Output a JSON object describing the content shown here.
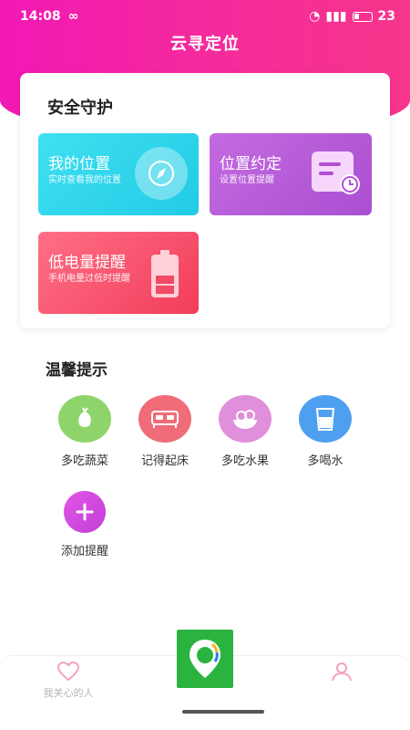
{
  "status_bar": {
    "time": "14:08",
    "battery_level": "23"
  },
  "app": {
    "title": "云寻定位"
  },
  "safety": {
    "title": "安全守护",
    "tiles": [
      {
        "title": "我的位置",
        "subtitle": "实时查看我的位置"
      },
      {
        "title": "位置约定",
        "subtitle": "设置位置提醒"
      },
      {
        "title": "低电量提醒",
        "subtitle": "手机电量过低时提醒"
      }
    ]
  },
  "tips": {
    "title": "温馨提示",
    "items": [
      {
        "label": "多吃蔬菜",
        "icon": "vegetable-icon",
        "color": "#8ed46a"
      },
      {
        "label": "记得起床",
        "icon": "bed-icon",
        "color": "#ef6c78"
      },
      {
        "label": "多吃水果",
        "icon": "fruit-icon",
        "color": "#e08fda"
      },
      {
        "label": "多喝水",
        "icon": "water-cup-icon",
        "color": "#4f9ff0"
      },
      {
        "label": "添加提醒",
        "icon": "plus-icon",
        "color": "#d24bdf"
      }
    ]
  },
  "nav": {
    "care_label": "我关心的人",
    "center_icon": "location-pin-icon",
    "me_icon": "person-icon"
  },
  "colors": {
    "brand": "#f52a9d",
    "center_button": "#2ab43f"
  }
}
